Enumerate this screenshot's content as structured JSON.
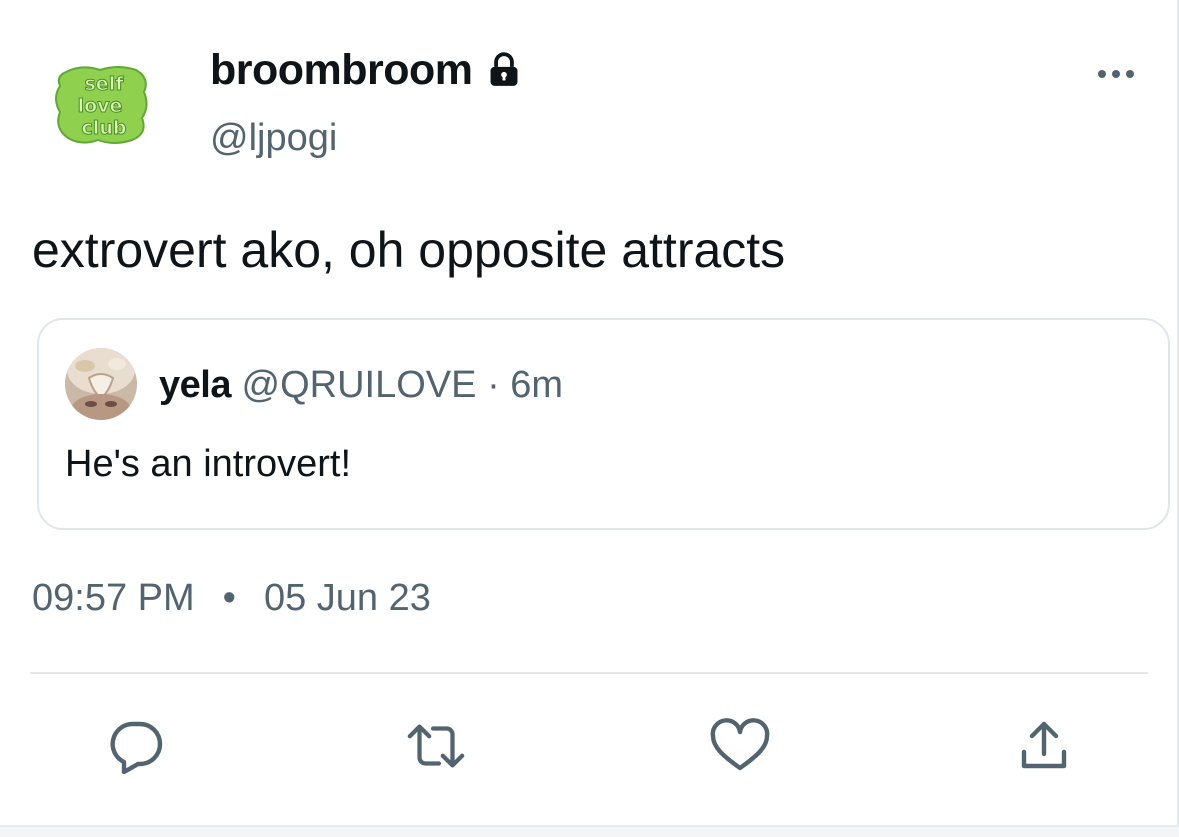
{
  "tweet": {
    "display_name": "broombroom",
    "handle": "@ljpogi",
    "avatar": {
      "icon": "self-love-club-logo",
      "text": "self love club",
      "color": "#8fd14f"
    },
    "text": "extrovert ako, oh opposite attracts",
    "time": "09:57 PM",
    "separator": "•",
    "date": "05 Jun 23"
  },
  "quote": {
    "name": "yela",
    "handle": "@QRUILOVE",
    "dot": "·",
    "age": "6m",
    "text": "He's an introvert!"
  },
  "actions": [
    {
      "icon": "reply-icon"
    },
    {
      "icon": "retweet-icon"
    },
    {
      "icon": "like-icon"
    },
    {
      "icon": "share-icon"
    }
  ],
  "colors": {
    "text": "#0f1419",
    "muted": "#536471",
    "border": "#e1e6ea",
    "icon": "#536471"
  }
}
